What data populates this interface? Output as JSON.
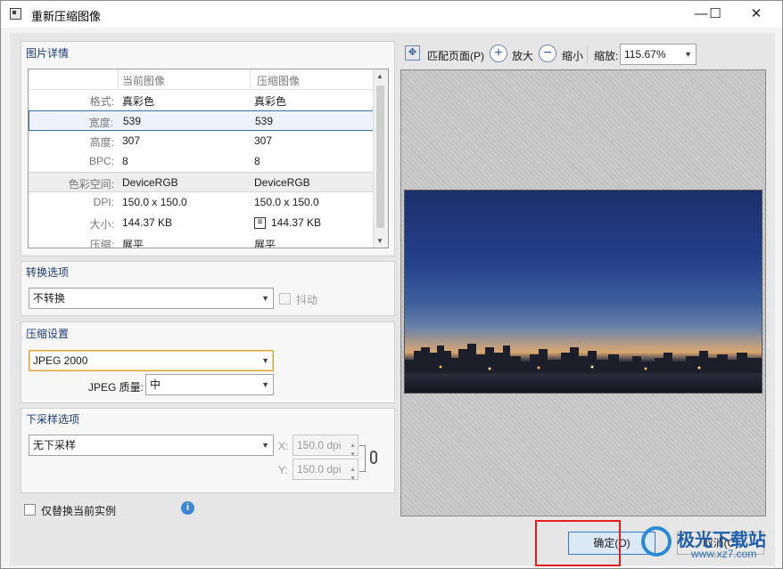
{
  "window": {
    "title": "重新压缩图像",
    "minimize": "—",
    "maximize": "☐",
    "close": "✕"
  },
  "details": {
    "title": "图片详情",
    "col_current": "当前图像",
    "col_compressed": "压缩图像",
    "rows": [
      {
        "key": "格式:",
        "current": "真彩色",
        "compressed": "真彩色"
      },
      {
        "key": "宽度:",
        "current": "539",
        "compressed": "539"
      },
      {
        "key": "高度:",
        "current": "307",
        "compressed": "307"
      },
      {
        "key": "BPC:",
        "current": "8",
        "compressed": "8"
      },
      {
        "key": "色彩空间:",
        "current": "DeviceRGB",
        "compressed": "DeviceRGB"
      },
      {
        "key": "DPI:",
        "current": "150.0 x 150.0",
        "compressed": "150.0 x 150.0"
      },
      {
        "key": "大小:",
        "current": "144.37 KB",
        "compressed": "144.37 KB"
      },
      {
        "key": "压缩:",
        "current": "展平",
        "compressed": "展平"
      }
    ]
  },
  "convert": {
    "title": "转换选项",
    "selected": "不转换",
    "dither_label": "抖动"
  },
  "compression": {
    "title": "压缩设置",
    "selected": "JPEG 2000",
    "quality_label": "JPEG 质量:",
    "quality_value": "中"
  },
  "downsample": {
    "title": "下采样选项",
    "selected": "无下采样",
    "x_label": "X:",
    "x_value": "150.0 dpi",
    "y_label": "Y:",
    "y_value": "150.0 dpi"
  },
  "replace_instance_label": "仅替换当前实例",
  "toolbar": {
    "fit_page": "匹配页面(P)",
    "zoom_in": "放大",
    "zoom_out": "缩小",
    "zoom_label": "缩放:",
    "zoom_value": "115.67%"
  },
  "buttons": {
    "ok": "确定(O)",
    "cancel": "取消(C)"
  },
  "watermark": {
    "brand": "极光下载站",
    "url": "www.xz7.com"
  },
  "colors": {
    "accent": "#3a78c6",
    "highlight": "#e11d1d"
  }
}
